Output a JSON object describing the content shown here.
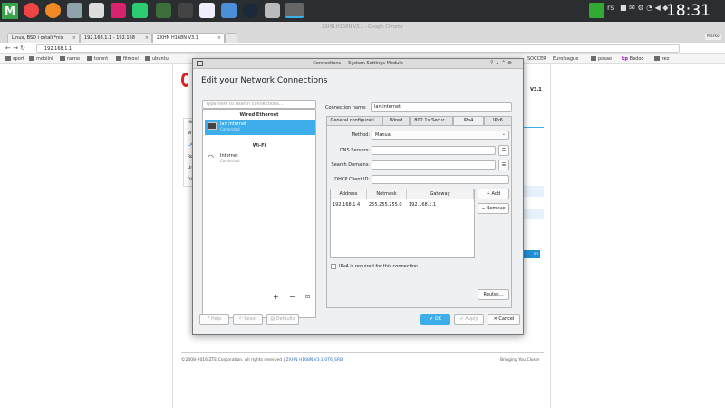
{
  "taskbar": {
    "start_label": "M",
    "tray_text": "rs",
    "clock": "18:31"
  },
  "browser": {
    "window_title": "ZXHN H168N V3.1 - Google Chrome",
    "tabs": [
      {
        "label": "Linux, BSD i ostali *nix"
      },
      {
        "label": "192.168.1.1 - 192.168"
      },
      {
        "label": "ZXHN H168N V3.1"
      }
    ],
    "url": "192.168.1.1",
    "user_badge": "Marko",
    "bookmarks": [
      {
        "label": "sport"
      },
      {
        "label": "mobilni"
      },
      {
        "label": "razno"
      },
      {
        "label": "torent"
      },
      {
        "label": "filmovi"
      },
      {
        "label": "ubuntu"
      },
      {
        "label": "SOCCER"
      },
      {
        "label": "Euroleague"
      },
      {
        "label": "posao"
      },
      {
        "label": "Badoo"
      },
      {
        "label": "zez"
      }
    ]
  },
  "router_page": {
    "version_badge": "V3.1",
    "footer_copyright": "©2008-2016 ZTE Corporation. All rights reserved",
    "footer_separator": "|",
    "footer_link": "ZXHN H168N V3.1.0T6_SRB",
    "footer_slogan": "Bringing You Closer",
    "side_items": [
      "IN",
      "W",
      "LA",
      "Ro",
      "Un",
      "DI"
    ],
    "button_label": "sh"
  },
  "dialog": {
    "window_title": "Connections — System Settings Module",
    "heading": "Edit your Network Connections",
    "search_placeholder": "Type here to search connections...",
    "groups": [
      {
        "label": "Wired Ethernet",
        "items": [
          {
            "name": "lan internet",
            "status": "Connected"
          }
        ]
      },
      {
        "label": "Wi-Fi",
        "items": [
          {
            "name": "Internet",
            "status": "Connected"
          }
        ]
      }
    ],
    "list_buttons": {
      "add": "+",
      "remove": "−",
      "import": "⊡"
    },
    "connection_name_label": "Connection name:",
    "connection_name_value": "lan internet",
    "tabs": [
      {
        "label": "General configurati..."
      },
      {
        "label": "Wired"
      },
      {
        "label": "802.1x Secur..."
      },
      {
        "label": "IPv4"
      },
      {
        "label": "IPv6"
      }
    ],
    "ipv4": {
      "method_label": "Method:",
      "method_value": "Manual",
      "dns_label": "DNS Servers:",
      "dns_value": "",
      "search_label": "Search Domains:",
      "search_value": "",
      "dhcp_label": "DHCP Client ID:",
      "dhcp_value": "",
      "columns": [
        "Address",
        "Netmask",
        "Gateway"
      ],
      "rows": [
        [
          "192.168.1.4",
          "255.255.255.0",
          "192.168.1.1"
        ]
      ],
      "add_label": "+ Add",
      "remove_label": "− Remove",
      "required_label": "IPv4 is required for this connection",
      "routes_label": "Routes..."
    },
    "footer": {
      "help": "Help",
      "reset": "Reset",
      "defaults": "Defaults",
      "ok": "OK",
      "apply": "Apply",
      "cancel": "Cancel"
    }
  },
  "colors": {
    "accent": "#3daee9",
    "taskbar": "#2b2e30",
    "dialog_bg": "#eff0f1"
  }
}
